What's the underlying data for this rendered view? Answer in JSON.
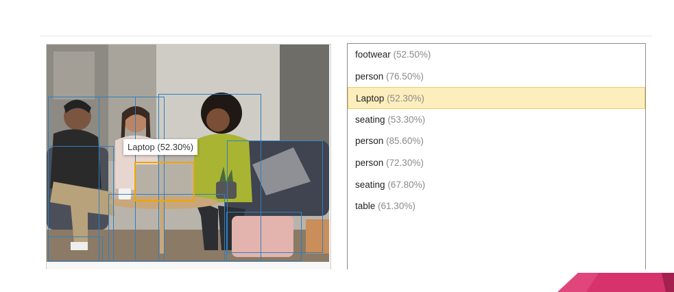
{
  "tooltip": {
    "text": "Laptop (52.30%)"
  },
  "detections": [
    {
      "label": "footwear",
      "confidence": "(52.50%)",
      "selected": false
    },
    {
      "label": "person",
      "confidence": "(76.50%)",
      "selected": false
    },
    {
      "label": "Laptop",
      "confidence": "(52.30%)",
      "selected": true
    },
    {
      "label": "seating",
      "confidence": "(53.30%)",
      "selected": false
    },
    {
      "label": "person",
      "confidence": "(85.60%)",
      "selected": false
    },
    {
      "label": "person",
      "confidence": "(72.30%)",
      "selected": false
    },
    {
      "label": "seating",
      "confidence": "(67.80%)",
      "selected": false
    },
    {
      "label": "table",
      "confidence": "(61.30%)",
      "selected": false
    }
  ],
  "colors": {
    "box_default": "#2f7fc1",
    "box_selected": "#f0a500",
    "row_selected_bg": "#fdeebd",
    "accent": "#d6336c"
  }
}
